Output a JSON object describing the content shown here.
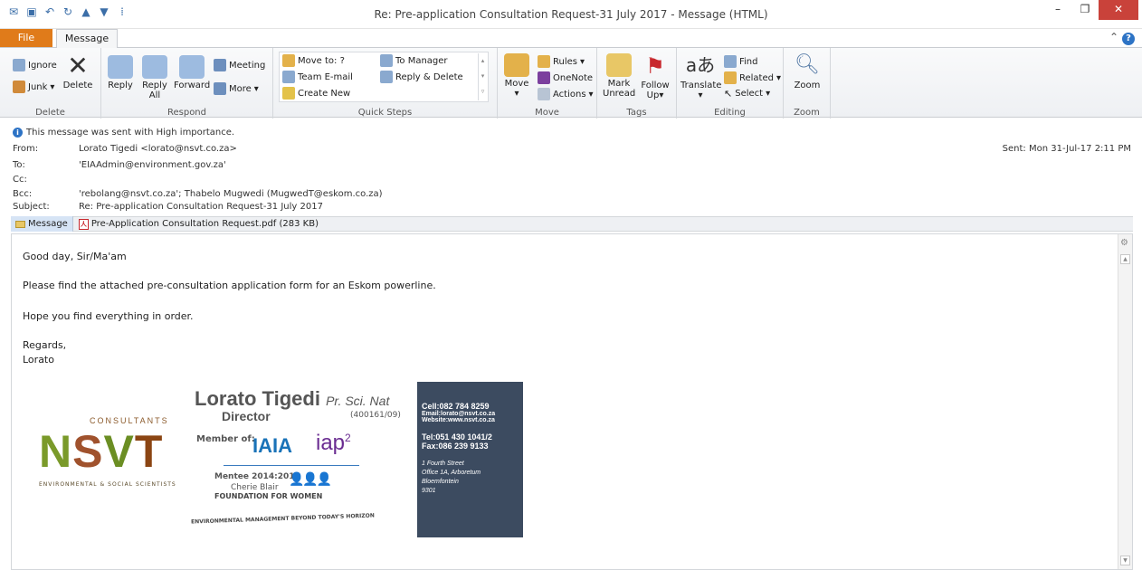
{
  "window": {
    "title": "Re: Pre-application Consultation Request-31 July 2017  -  Message (HTML)"
  },
  "tabs": [
    {
      "label": "File"
    },
    {
      "label": "Message"
    }
  ],
  "ribbon": {
    "delete_group": {
      "label": "Delete",
      "ignore": "Ignore",
      "junk": "Junk",
      "delete": "Delete"
    },
    "respond_group": {
      "label": "Respond",
      "reply": "Reply",
      "reply_all_1": "Reply",
      "reply_all_2": "All",
      "forward": "Forward",
      "meeting": "Meeting",
      "more": "More"
    },
    "quick_steps_group": {
      "label": "Quick Steps",
      "move_to": "Move to: ?",
      "team_email": "Team E-mail",
      "create_new": "Create New",
      "to_manager": "To Manager",
      "reply_delete": "Reply & Delete"
    },
    "move_group": {
      "label": "Move",
      "move": "Move",
      "rules": "Rules",
      "onenote": "OneNote",
      "actions": "Actions"
    },
    "tags_group": {
      "label": "Tags",
      "mark_unread_1": "Mark",
      "mark_unread_2": "Unread",
      "follow_up_1": "Follow",
      "follow_up_2": "Up"
    },
    "editing_group": {
      "label": "Editing",
      "translate": "Translate",
      "find": "Find",
      "related": "Related",
      "select": "Select"
    },
    "zoom_group": {
      "label": "Zoom",
      "zoom": "Zoom"
    }
  },
  "header": {
    "importance": "This message was sent with High importance.",
    "from_label": "From:",
    "from": "Lorato Tigedi <lorato@nsvt.co.za>",
    "to_label": "To:",
    "to": "'EIAAdmin@environment.gov.za'",
    "cc_label": "Cc:",
    "cc": "",
    "bcc_label": "Bcc:",
    "bcc": "'rebolang@nsvt.co.za'; Thabelo Mugwedi (MugwedT@eskom.co.za)",
    "subject_label": "Subject:",
    "subject": "Re: Pre-application Consultation Request-31 July 2017",
    "sent": "Sent:  Mon 31-Jul-17 2:11 PM"
  },
  "attachments": {
    "message_tab": "Message",
    "file": "Pre-Application Consultation Request.pdf (283 KB)"
  },
  "body": {
    "greeting": "Good day, Sir/Ma'am",
    "line1": "Please find the attached pre-consultation application form for an Eskom powerline.",
    "line2": "Hope you find everything in order.",
    "closing": "Regards,",
    "name": "Lorato"
  },
  "signature": {
    "consultants": "CONSULTANTS",
    "logo_n": "N",
    "logo_s": "S",
    "logo_v": "V",
    "logo_t": "T",
    "tagline": "ENVIRONMENTAL & SOCIAL SCIENTISTS",
    "name": "Lorato Tigedi",
    "title_suffix": "Pr. Sci. Nat",
    "role": "Director",
    "reg_no": "(400161/09)",
    "member_of": "Member of:",
    "iaia": "IAIA",
    "iap": "iap",
    "iap_sup": "2",
    "mentee": "Mentee 2014:2015",
    "cherie": "Cherie Blair",
    "foundation": "FOUNDATION FOR WOMEN",
    "motto": "ENVIRONMENTAL MANAGEMENT BEYOND TODAY'S HORIZON",
    "cell": "Cell:082 784 8259",
    "email": "Email:lorato@nsvt.co.za",
    "website": "Website:www.nsvt.co.za",
    "tel": "Tel:051 430 1041/2",
    "fax": "Fax:086 239 9133",
    "addr1": "1 Fourth Street",
    "addr2": "Office 1A, Arboretum",
    "addr3": "Bloemfontein",
    "addr4": "9301"
  },
  "colors": {
    "file_tab": "#e07b1a",
    "close_button": "#c9423a",
    "contact_panel": "#3c4b60",
    "accent_blue": "#2d73c5"
  }
}
